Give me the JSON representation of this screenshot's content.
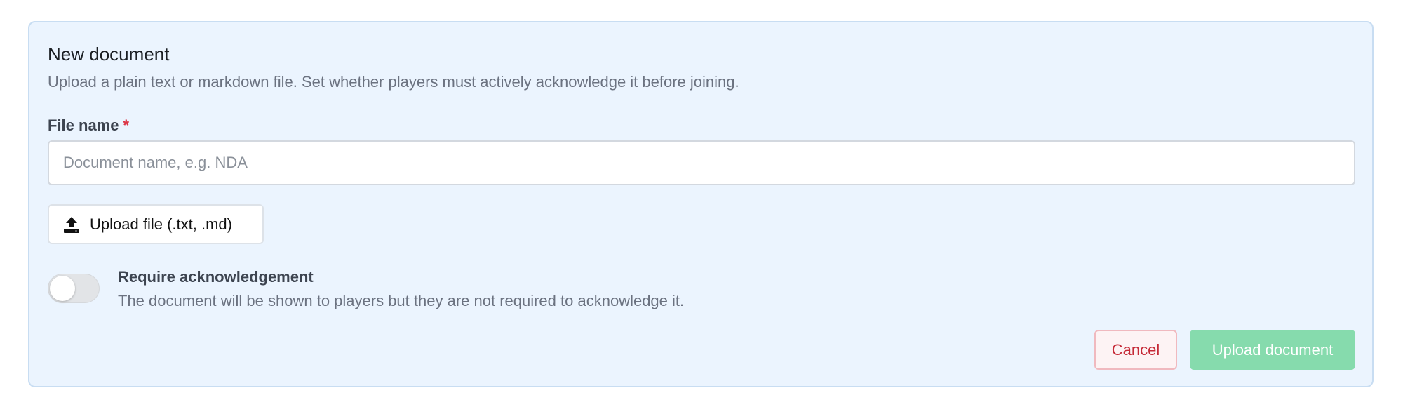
{
  "form": {
    "title": "New document",
    "subtitle": "Upload a plain text or markdown file. Set whether players must actively acknowledge it before joining.",
    "file_name": {
      "label": "File name",
      "required_marker": "*",
      "placeholder": "Document name, e.g. NDA",
      "value": ""
    },
    "upload_button": {
      "icon": "upload-icon",
      "label": "Upload file (.txt, .md)"
    },
    "acknowledgement": {
      "enabled": false,
      "title": "Require acknowledgement",
      "description": "The document will be shown to players but they are not required to acknowledge it."
    },
    "actions": {
      "cancel_label": "Cancel",
      "submit_label": "Upload document",
      "submit_disabled": true
    }
  },
  "colors": {
    "panel_background": "#ebf4fe",
    "panel_border": "#c8ddf2",
    "required_marker": "#dc3545",
    "cancel_text": "#c52a37",
    "cancel_border": "#f0b9bf",
    "submit_background_disabled": "#86dbad"
  }
}
